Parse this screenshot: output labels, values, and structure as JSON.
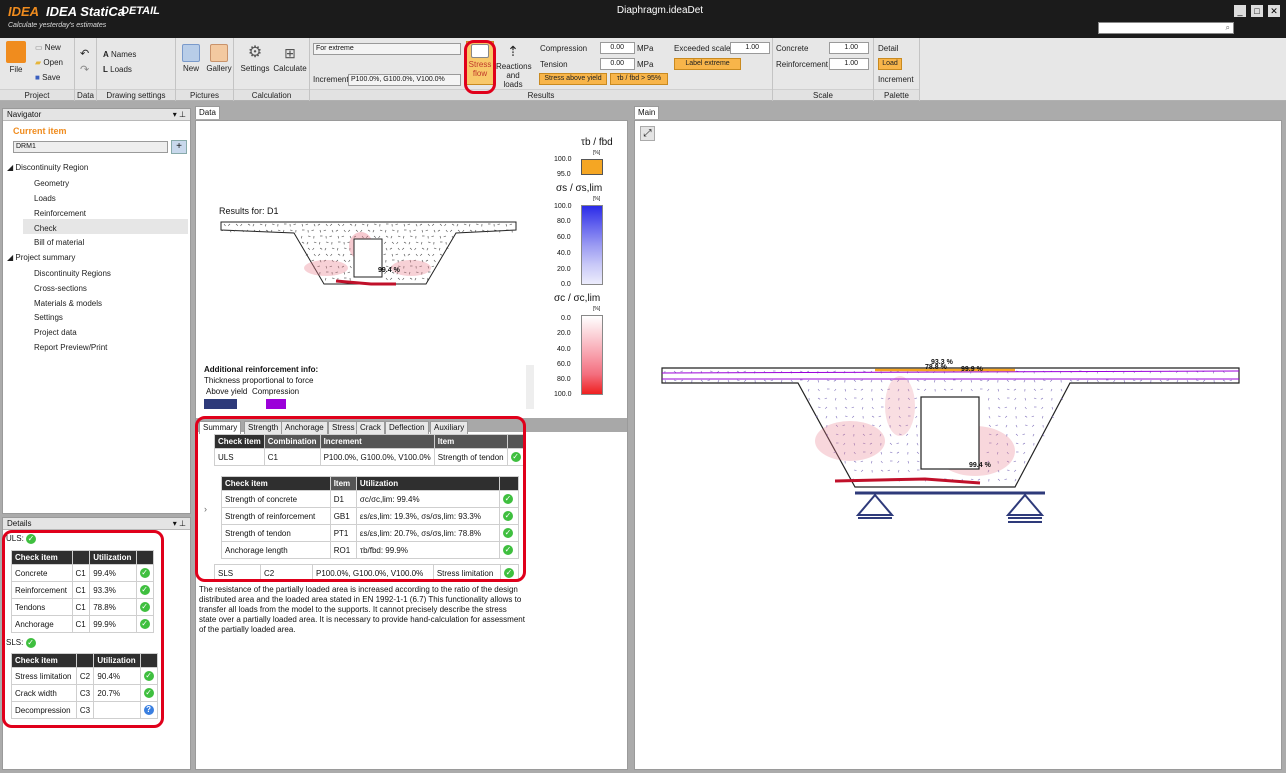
{
  "app": {
    "brand": "IDEA StatiCa",
    "tagline": "Calculate yesterday's estimates",
    "module": "DETAIL",
    "file_title": "Diaphragm.ideaDet"
  },
  "ribbon": {
    "file_label": "File",
    "new_label": "New",
    "open_label": "Open",
    "save_label": "Save",
    "names_label": "Names",
    "loads_label": "Loads",
    "new_pic_label": "New",
    "gallery_label": "Gallery",
    "settings_label": "Settings",
    "calculate_label": "Calculate",
    "extreme_select": "For extreme",
    "increment_label": "Increment",
    "increment_select": "P100.0%, G100.0%, V100.0%",
    "stress_flow_label": "Stress flow",
    "reactions_label": "Reactions and loads",
    "compression_label": "Compression",
    "compression_value": "0.00",
    "compression_unit": "MPa",
    "tension_label": "Tension",
    "tension_value": "0.00",
    "tension_unit": "MPa",
    "stress_above_yield": "Stress above yield",
    "tb_ratio_label": "τb / fbd > 95%",
    "exceeded_scale_label": "Exceeded scale",
    "exceeded_scale_value": "1.00",
    "label_extreme": "Label extreme",
    "concrete_label": "Concrete",
    "concrete_value": "1.00",
    "reinforcement_label": "Reinforcement",
    "reinforcement_value": "1.00",
    "detail_label": "Detail",
    "load_btn": "Load",
    "increment_btn": "Increment",
    "groups": [
      "Project",
      "Data",
      "Drawing settings",
      "Pictures",
      "Calculation",
      "Results",
      "Scale",
      "Palette"
    ]
  },
  "navigator": {
    "title": "Navigator",
    "current_item_label": "Current item",
    "current_item": "DRM1",
    "tree_root1": "Discontinuity Region",
    "items1": [
      "Geometry",
      "Loads",
      "Reinforcement",
      "Check",
      "Bill of material"
    ],
    "tree_root2": "Project summary",
    "items2": [
      "Discontinuity Regions",
      "Cross-sections",
      "Materials & models",
      "Settings",
      "Project data",
      "Report Preview/Print"
    ]
  },
  "details": {
    "title": "Details",
    "uls_label": "ULS:",
    "sls_label": "SLS:",
    "col_check": "Check item",
    "col_util": "Utilization",
    "uls_rows": [
      {
        "item": "Concrete",
        "comb": "C1",
        "util": "99.4%"
      },
      {
        "item": "Reinforcement",
        "comb": "C1",
        "util": "93.3%"
      },
      {
        "item": "Tendons",
        "comb": "C1",
        "util": "78.8%"
      },
      {
        "item": "Anchorage",
        "comb": "C1",
        "util": "99.9%"
      }
    ],
    "sls_rows": [
      {
        "item": "Stress limitation",
        "comb": "C2",
        "util": "90.4%"
      },
      {
        "item": "Crack width",
        "comb": "C3",
        "util": "20.7%"
      },
      {
        "item": "Decompression",
        "comb": "C3",
        "util": ""
      }
    ]
  },
  "data_panel": {
    "tab": "Data",
    "results_for": "Results for: D1",
    "peak_label": "99.4 %",
    "legend_tb_title": "τb / fbd",
    "legend_s_title": "σs / σs,lim",
    "legend_c_title": "σc / σc,lim",
    "unit": "[%]",
    "tb_ticks": [
      "100.0",
      "95.0"
    ],
    "s_ticks": [
      "100.0",
      "80.0",
      "60.0",
      "40.0",
      "20.0",
      "0.0"
    ],
    "c_ticks": [
      "0.0",
      "20.0",
      "40.0",
      "60.0",
      "80.0",
      "100.0"
    ],
    "add_info_title": "Additional reinforcement info:",
    "add_info_sub": "Thickness proportional to force",
    "above_yield": "Above yield",
    "compression": "Compression",
    "colors": {
      "above_yield": "#2e3a7a",
      "compression": "#9b00d9",
      "tb": "#f5a623"
    }
  },
  "result_tabs": [
    "Summary",
    "Strength",
    "Anchorage",
    "Stress",
    "Crack",
    "Deflection",
    "Auxiliary"
  ],
  "summary": {
    "head": [
      "Check item",
      "Combination",
      "Increment",
      "Item"
    ],
    "uls": {
      "check": "ULS",
      "comb": "C1",
      "incr": "P100.0%, G100.0%, V100.0%",
      "item": "Strength of tendon"
    },
    "sub_head": [
      "Check item",
      "Item",
      "Utilization"
    ],
    "sub_rows": [
      {
        "check": "Strength of concrete",
        "item": "D1",
        "util": "σc/σc,lim: 99.4%"
      },
      {
        "check": "Strength of reinforcement",
        "item": "GB1",
        "util": "εs/εs,lim: 19.3%, σs/σs,lim: 93.3%"
      },
      {
        "check": "Strength of tendon",
        "item": "PT1",
        "util": "εs/εs,lim: 20.7%, σs/σs,lim: 78.8%"
      },
      {
        "check": "Anchorage length",
        "item": "RO1",
        "util": "τb/fbd: 99.9%"
      }
    ],
    "sls": {
      "check": "SLS",
      "comb": "C2",
      "incr": "P100.0%, G100.0%, V100.0%",
      "item": "Stress limitation"
    },
    "note": "The resistance of the partially loaded area is increased according to the ratio of the design distributed area and the loaded area stated in EN 1992-1-1  (6.7) This functionality allows to transfer all loads from the model to the supports. It cannot precisely describe the stress state over a partially loaded area. It is necessary to provide hand-calculation for assessment of the partially loaded area."
  },
  "main_panel": {
    "tab": "Main",
    "label_top": "93.3 %",
    "label_a": "78.8 %",
    "label_b": "99.9 %",
    "label_peak": "99.4 %"
  }
}
